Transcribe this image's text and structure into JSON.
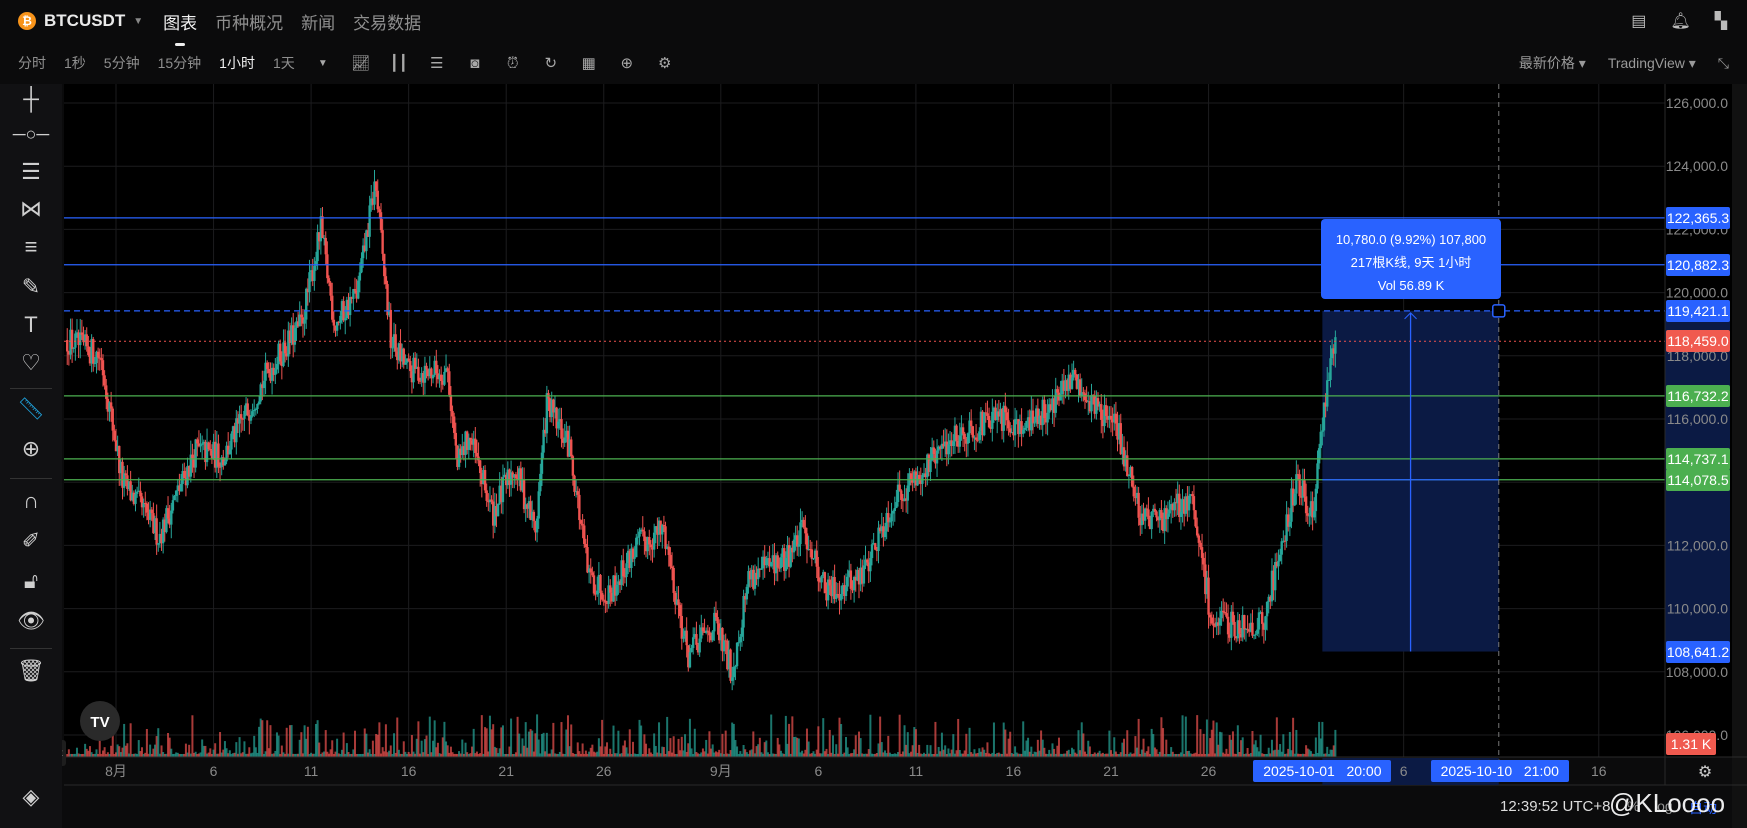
{
  "header": {
    "symbol": "BTCUSDT",
    "tabs": [
      {
        "label": "图表",
        "active": true
      },
      {
        "label": "币种概况"
      },
      {
        "label": "新闻"
      },
      {
        "label": "交易数据"
      }
    ],
    "icons": [
      "notebook-icon",
      "alert-icon",
      "apps-icon"
    ]
  },
  "toolbar": {
    "intervals": [
      "分时",
      "1秒",
      "5分钟",
      "15分钟",
      "1小时",
      "1天"
    ],
    "active_interval": "1小时",
    "icons": [
      "indicators-icon",
      "candle-type-icon",
      "template-icon",
      "camera-icon",
      "alarm-icon",
      "replay-icon",
      "calendar-icon",
      "add-icon",
      "settings-icon"
    ],
    "price_source": "最新价格",
    "chart_style": "TradingView"
  },
  "left_tools": [
    "crosshair-icon",
    "horizontal-line-icon",
    "parallel-lines-icon",
    "pattern-icon",
    "fib-icon",
    "brush-icon",
    "text-icon",
    "heart-icon",
    "ruler-icon",
    "zoom-in-icon",
    "magnet-icon",
    "lock-drawing-icon",
    "unlock-icon",
    "eye-icon",
    "trash-icon",
    "layers-icon"
  ],
  "colors": {
    "up": "#26a69a",
    "down": "#ef5350",
    "accent": "#2962ff",
    "green_line": "#4caf50",
    "red_label": "#f05a4f"
  },
  "chart_data": {
    "type": "candlestick",
    "interval": "1小时",
    "y_ticks": [
      126000,
      124000,
      122000,
      120000,
      118000,
      116000,
      114000,
      112000,
      110000,
      108000,
      106000
    ],
    "y_tick_labels": [
      "126,000.0",
      "124,000.0",
      "122,000.0",
      "120,000.0",
      "118,000.0",
      "116,000.0",
      "114,000.0",
      "112,000.0",
      "110,000.0",
      "108,000.0",
      "106,000.0"
    ],
    "ylim": [
      105500,
      127000
    ],
    "x_range": [
      "2025-07-29T12",
      "2025-10-19T00"
    ],
    "x_ticks": [
      {
        "date": "2025-08-01",
        "label": "8月"
      },
      {
        "date": "2025-08-06",
        "label": "6"
      },
      {
        "date": "2025-08-11",
        "label": "11"
      },
      {
        "date": "2025-08-16",
        "label": "16"
      },
      {
        "date": "2025-08-21",
        "label": "21"
      },
      {
        "date": "2025-08-26",
        "label": "26"
      },
      {
        "date": "2025-09-01",
        "label": "9月"
      },
      {
        "date": "2025-09-06",
        "label": "6"
      },
      {
        "date": "2025-09-11",
        "label": "11"
      },
      {
        "date": "2025-09-16",
        "label": "16"
      },
      {
        "date": "2025-09-21",
        "label": "21"
      },
      {
        "date": "2025-09-26",
        "label": "26"
      },
      {
        "date": "2025-10-06",
        "label": "6"
      },
      {
        "date": "2025-10-16",
        "label": "16"
      }
    ],
    "price_path": [
      [
        "2025-07-29T12",
        118500
      ],
      [
        "2025-07-31T05",
        118000
      ],
      [
        "2025-08-01T08",
        114000
      ],
      [
        "2025-08-02T12",
        113000
      ],
      [
        "2025-08-03T05",
        112300
      ],
      [
        "2025-08-05T02",
        115000
      ],
      [
        "2025-08-06T12",
        114800
      ],
      [
        "2025-08-08T19",
        117500
      ],
      [
        "2025-08-10T12",
        119000
      ],
      [
        "2025-08-11T12",
        122000
      ],
      [
        "2025-08-12T05",
        119000
      ],
      [
        "2025-08-13T09",
        120000
      ],
      [
        "2025-08-14T07",
        123500
      ],
      [
        "2025-08-15T02",
        118500
      ],
      [
        "2025-08-16T00",
        117500
      ],
      [
        "2025-08-18T00",
        117500
      ],
      [
        "2025-08-18T12",
        114500
      ],
      [
        "2025-08-19T02",
        115500
      ],
      [
        "2025-08-20T07",
        113000
      ],
      [
        "2025-08-21T10",
        114500
      ],
      [
        "2025-08-22T12",
        112500
      ],
      [
        "2025-08-23T02",
        116500
      ],
      [
        "2025-08-24T07",
        115000
      ],
      [
        "2025-08-25T05",
        111000
      ],
      [
        "2025-08-26T07",
        110500
      ],
      [
        "2025-08-27T17",
        112000
      ],
      [
        "2025-08-29T02",
        112500
      ],
      [
        "2025-08-30T07",
        108500
      ],
      [
        "2025-08-31T17",
        109500
      ],
      [
        "2025-09-01T14",
        108000
      ],
      [
        "2025-09-02T10",
        111000
      ],
      [
        "2025-09-04T05",
        111500
      ],
      [
        "2025-09-05T07",
        112500
      ],
      [
        "2025-09-06T10",
        110500
      ],
      [
        "2025-09-08T05",
        111000
      ],
      [
        "2025-09-09T22",
        113500
      ],
      [
        "2025-09-11T14",
        114500
      ],
      [
        "2025-09-13T00",
        115500
      ],
      [
        "2025-09-15T07",
        116000
      ],
      [
        "2025-09-16T19",
        115800
      ],
      [
        "2025-09-19T02",
        117200
      ],
      [
        "2025-09-21T07",
        115700
      ],
      [
        "2025-09-22T12",
        113000
      ],
      [
        "2025-09-23T14",
        112800
      ],
      [
        "2025-09-25T02",
        113500
      ],
      [
        "2025-09-26T05",
        109500
      ],
      [
        "2025-09-28T19",
        109500
      ],
      [
        "2025-09-29T17",
        112000
      ],
      [
        "2025-09-30T12",
        114000
      ],
      [
        "2025-10-01T10",
        113000
      ],
      [
        "2025-10-01T22",
        116500
      ],
      [
        "2025-10-02T12",
        118459
      ]
    ],
    "last_price": {
      "value": 118459.0,
      "label": "118,459.0"
    },
    "last_volume": "1.31 K",
    "horizontal_lines": [
      {
        "value": 122365.3,
        "label": "122,365.3",
        "color": "#2962ff"
      },
      {
        "value": 120882.3,
        "label": "120,882.3",
        "color": "#2962ff"
      },
      {
        "value": 119421.1,
        "label": "119,421.1",
        "color": "#2962ff",
        "dashed": true
      },
      {
        "value": 116732.2,
        "label": "116,732.2",
        "color": "#4caf50"
      },
      {
        "value": 114737.1,
        "label": "114,737.1",
        "color": "#4caf50"
      },
      {
        "value": 114078.5,
        "label": "114,078.5",
        "color": "#4caf50"
      }
    ],
    "measure": {
      "from_date": "2025-10-01T20",
      "to_date": "2025-10-10T21",
      "low": 108641.2,
      "low_label": "108,641.2",
      "high": 119421.1,
      "from_label": "2025-10-01   20:00",
      "to_label": "2025-10-10   21:00",
      "line1": "10,780.0 (9.92%) 107,800",
      "line2": "217根K线, 9天 1小时",
      "line3": "Vol 56.89 K"
    }
  },
  "status": {
    "time": "12:39:52 UTC+8",
    "percent": "%",
    "log": "log",
    "auto": "自动",
    "watermark": "@KLoooo"
  }
}
